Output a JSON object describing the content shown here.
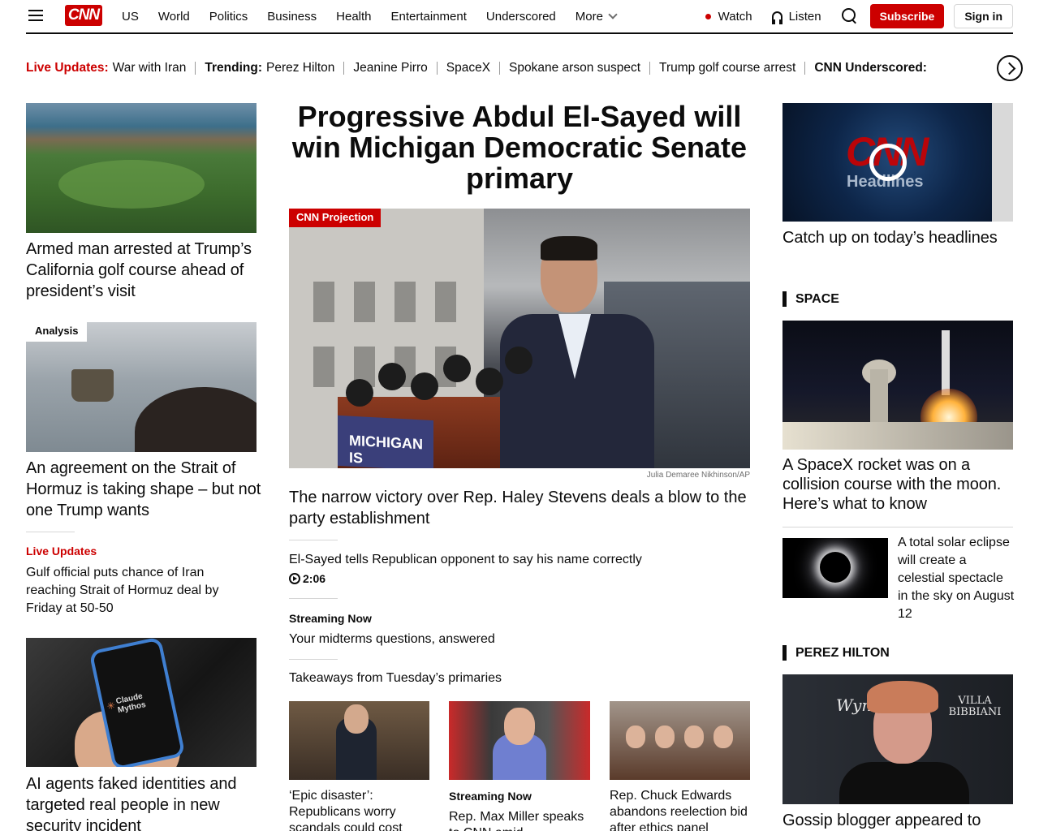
{
  "header": {
    "logo": "CNN",
    "nav": [
      "US",
      "World",
      "Politics",
      "Business",
      "Health",
      "Entertainment",
      "Underscored",
      "More"
    ],
    "watch": "Watch",
    "listen": "Listen",
    "subscribe": "Subscribe",
    "signin": "Sign in"
  },
  "ticker": {
    "live_label": "Live Updates:",
    "live_item": "War with Iran",
    "trending_label": "Trending:",
    "items": [
      "Perez Hilton",
      "Jeanine Pirro",
      "SpaceX",
      "Spokane arson suspect",
      "Trump golf course arrest"
    ],
    "underscored_label": "CNN Underscored:"
  },
  "left": {
    "story1": "Armed man arrested at Trump’s California golf course ahead of president’s visit",
    "story2_badge": "Analysis",
    "story2": "An agreement on the Strait of Hormuz is taking shape – but not one Trump wants",
    "live_kicker": "Live Updates",
    "live_text": "Gulf official puts chance of Iran reaching Strait of Hormuz deal by Friday at 50-50",
    "story3_phone_title": "Claude Mythos",
    "story3": "AI agents faked identities and targeted real people in new security incident"
  },
  "center": {
    "title": "Progressive Abdul El-Sayed will win Michigan Democratic Senate primary",
    "badge": "CNN Projection",
    "podium_text": "MICHIGAN IS",
    "credit": "Julia Demaree Nikhinson/AP",
    "subhead": "The narrow victory over Rep. Haley Stevens deals a blow to the party establishment",
    "video_link": "El-Sayed tells Republican opponent to say his name correctly",
    "video_time": "2:06",
    "streaming_kicker": "Streaming Now",
    "streaming_link": "Your midterms questions, answered",
    "takeaways": "Takeaways from Tuesday’s primaries",
    "cards": [
      {
        "headline": "‘Epic disaster’: Republicans worry scandals could cost"
      },
      {
        "kicker": "Streaming Now",
        "headline": "Rep. Max Miller speaks to CNN amid"
      },
      {
        "headline": "Rep. Chuck Edwards abandons reelection bid after ethics panel"
      }
    ]
  },
  "right": {
    "video_logo": "CNN",
    "video_sub": "Headlines",
    "video_caption": "Catch up on today’s headlines",
    "section1": "SPACE",
    "space_story": "A SpaceX rocket was on a collision course with the moon. Here’s what to know",
    "eclipse_story": "A total solar eclipse will create a celestial spectacle in the sky on August 12",
    "section2": "PEREZ HILTON",
    "perez_logo_left": "Wynn",
    "perez_logo_right": "VILLA BIBBIANI",
    "perez_story": "Gossip blogger appeared to"
  },
  "colors": {
    "brand_red": "#cc0000",
    "text": "#0c0c0c",
    "rule": "#d6d6d6"
  }
}
